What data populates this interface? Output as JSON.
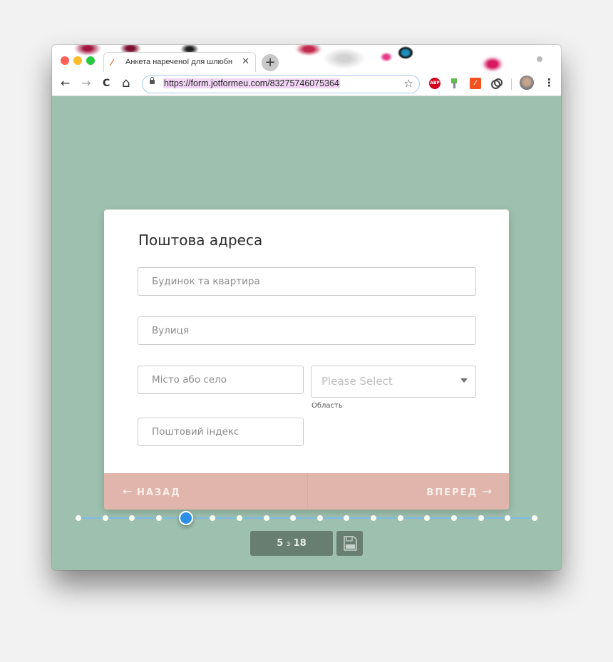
{
  "browser": {
    "tab": {
      "title": "Анкета нареченої для шлюбного",
      "favicon": "jotform-favicon"
    },
    "new_tab_label": "+",
    "address_bar": {
      "url": "https://form.jotformeu.com/83275746075364"
    },
    "nav_icons": {
      "back": "←",
      "forward": "→",
      "reload": "C",
      "home": "⌂"
    },
    "bookmark_icon": "☆",
    "extensions": [
      "adblock-plus",
      "green-extension",
      "code-extension",
      "link-extension"
    ],
    "abp_label": "ABP",
    "menu_icon": "⋮"
  },
  "form": {
    "title": "Поштова адреса",
    "fields": {
      "house": {
        "placeholder": "Будинок та квартира",
        "value": ""
      },
      "street": {
        "placeholder": "Вулиця",
        "value": ""
      },
      "city": {
        "placeholder": "Місто або село",
        "value": ""
      },
      "region": {
        "selected": "Please Select",
        "label": "Область"
      },
      "postal": {
        "placeholder": "Поштовий індекс",
        "value": ""
      }
    },
    "nav": {
      "back_label": "НАЗАД",
      "back_arrow": "←",
      "next_label": "ВПЕРЕД",
      "next_arrow": "→"
    }
  },
  "progress": {
    "current": 5,
    "total": 18,
    "separator": "з",
    "accent": "#2d8ee6"
  },
  "colors": {
    "page_bg": "#9ec1af",
    "nav_bg": "#e0b6ac",
    "counter_bg": "#677e70"
  }
}
